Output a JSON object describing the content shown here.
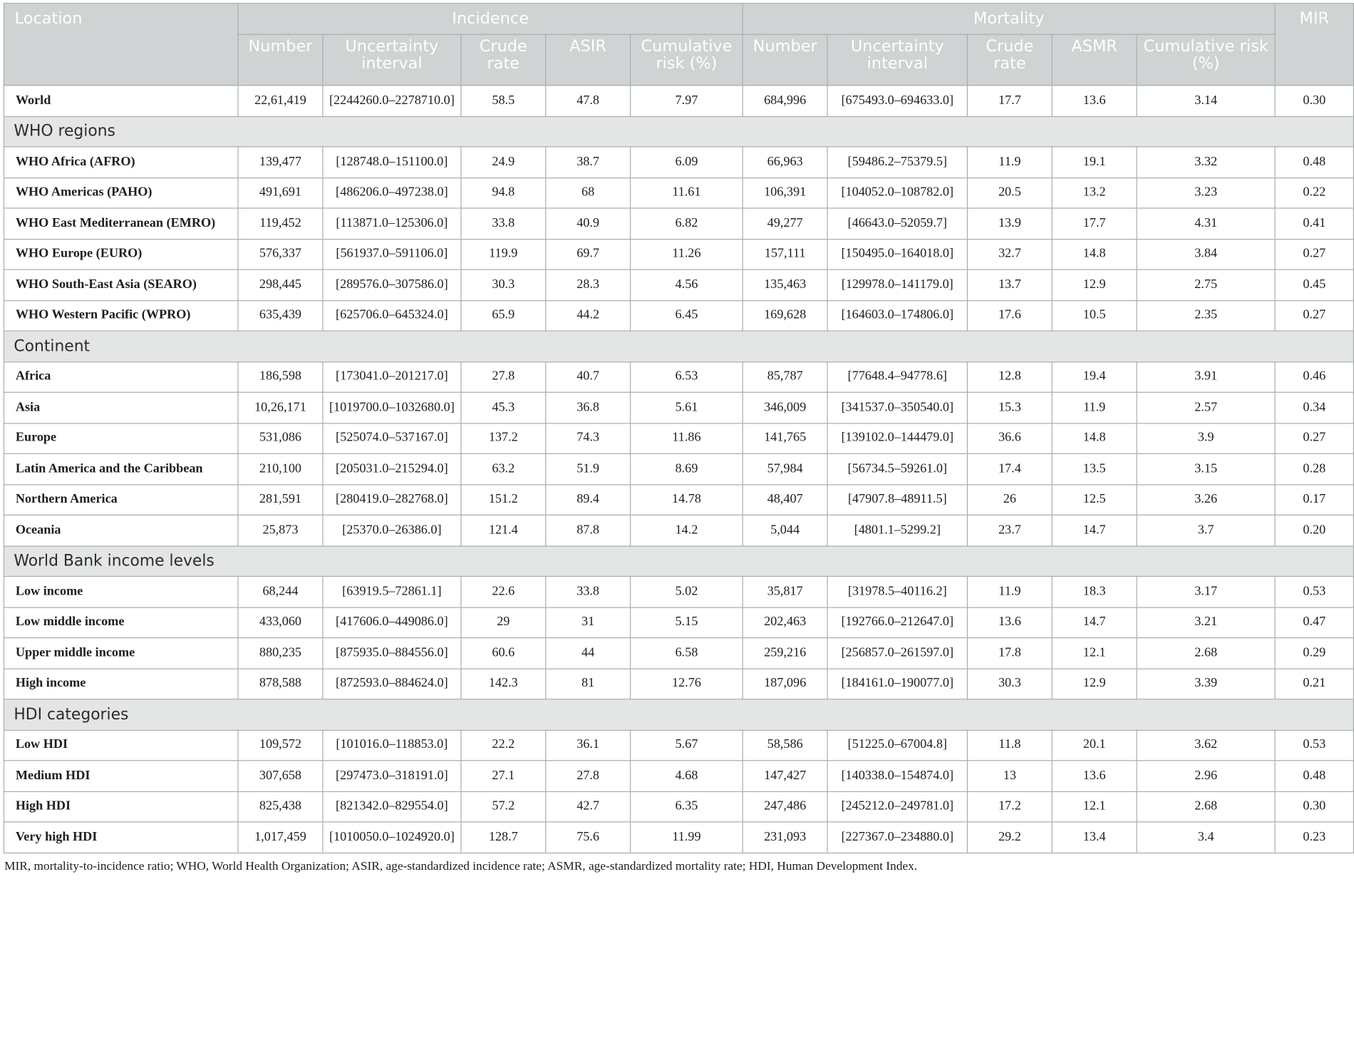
{
  "table": {
    "headers": {
      "location": "Location",
      "incidence": "Incidence",
      "mortality": "Mortality",
      "mir": "MIR",
      "inc_number": "Number",
      "inc_uncertainty": "Uncertainty interval",
      "inc_crude": "Crude rate",
      "inc_asir": "ASIR",
      "inc_cumrisk": "Cumulative risk (%)",
      "mort_number": "Number",
      "mort_uncertainty": "Uncertainty interval",
      "mort_crude": "Crude rate",
      "mort_asmr": "ASMR",
      "mort_cumrisk": "Cumulative risk (%)"
    },
    "world": [
      "World",
      "22,61,419",
      "[2244260.0–2278710.0]",
      "58.5",
      "47.8",
      "7.97",
      "684,996",
      "[675493.0–694633.0]",
      "17.7",
      "13.6",
      "3.14",
      "0.30"
    ],
    "groups": [
      {
        "title": "WHO regions",
        "rows": [
          [
            "WHO Africa (AFRO)",
            "139,477",
            "[128748.0–151100.0]",
            "24.9",
            "38.7",
            "6.09",
            "66,963",
            "[59486.2–75379.5]",
            "11.9",
            "19.1",
            "3.32",
            "0.48"
          ],
          [
            "WHO Americas (PAHO)",
            "491,691",
            "[486206.0–497238.0]",
            "94.8",
            "68",
            "11.61",
            "106,391",
            "[104052.0–108782.0]",
            "20.5",
            "13.2",
            "3.23",
            "0.22"
          ],
          [
            "WHO East Mediterranean (EMRO)",
            "119,452",
            "[113871.0–125306.0]",
            "33.8",
            "40.9",
            "6.82",
            "49,277",
            "[46643.0–52059.7]",
            "13.9",
            "17.7",
            "4.31",
            "0.41"
          ],
          [
            "WHO Europe (EURO)",
            "576,337",
            "[561937.0–591106.0]",
            "119.9",
            "69.7",
            "11.26",
            "157,111",
            "[150495.0–164018.0]",
            "32.7",
            "14.8",
            "3.84",
            "0.27"
          ],
          [
            "WHO South-East Asia (SEARO)",
            "298,445",
            "[289576.0–307586.0]",
            "30.3",
            "28.3",
            "4.56",
            "135,463",
            "[129978.0–141179.0]",
            "13.7",
            "12.9",
            "2.75",
            "0.45"
          ],
          [
            "WHO Western Pacific (WPRO)",
            "635,439",
            "[625706.0–645324.0]",
            "65.9",
            "44.2",
            "6.45",
            "169,628",
            "[164603.0–174806.0]",
            "17.6",
            "10.5",
            "2.35",
            "0.27"
          ]
        ]
      },
      {
        "title": "Continent",
        "rows": [
          [
            "Africa",
            "186,598",
            "[173041.0–201217.0]",
            "27.8",
            "40.7",
            "6.53",
            "85,787",
            "[77648.4–94778.6]",
            "12.8",
            "19.4",
            "3.91",
            "0.46"
          ],
          [
            "Asia",
            "10,26,171",
            "[1019700.0–1032680.0]",
            "45.3",
            "36.8",
            "5.61",
            "346,009",
            "[341537.0–350540.0]",
            "15.3",
            "11.9",
            "2.57",
            "0.34"
          ],
          [
            "Europe",
            "531,086",
            "[525074.0–537167.0]",
            "137.2",
            "74.3",
            "11.86",
            "141,765",
            "[139102.0–144479.0]",
            "36.6",
            "14.8",
            "3.9",
            "0.27"
          ],
          [
            "Latin America and the Caribbean",
            "210,100",
            "[205031.0–215294.0]",
            "63.2",
            "51.9",
            "8.69",
            "57,984",
            "[56734.5–59261.0]",
            "17.4",
            "13.5",
            "3.15",
            "0.28"
          ],
          [
            "Northern America",
            "281,591",
            "[280419.0–282768.0]",
            "151.2",
            "89.4",
            "14.78",
            "48,407",
            "[47907.8–48911.5]",
            "26",
            "12.5",
            "3.26",
            "0.17"
          ],
          [
            "Oceania",
            "25,873",
            "[25370.0–26386.0]",
            "121.4",
            "87.8",
            "14.2",
            "5,044",
            "[4801.1–5299.2]",
            "23.7",
            "14.7",
            "3.7",
            "0.20"
          ]
        ]
      },
      {
        "title": "World Bank income levels",
        "rows": [
          [
            "Low income",
            "68,244",
            "[63919.5–72861.1]",
            "22.6",
            "33.8",
            "5.02",
            "35,817",
            "[31978.5–40116.2]",
            "11.9",
            "18.3",
            "3.17",
            "0.53"
          ],
          [
            "Low middle income",
            "433,060",
            "[417606.0–449086.0]",
            "29",
            "31",
            "5.15",
            "202,463",
            "[192766.0–212647.0]",
            "13.6",
            "14.7",
            "3.21",
            "0.47"
          ],
          [
            "Upper middle income",
            "880,235",
            "[875935.0–884556.0]",
            "60.6",
            "44",
            "6.58",
            "259,216",
            "[256857.0–261597.0]",
            "17.8",
            "12.1",
            "2.68",
            "0.29"
          ],
          [
            "High income",
            "878,588",
            "[872593.0–884624.0]",
            "142.3",
            "81",
            "12.76",
            "187,096",
            "[184161.0–190077.0]",
            "30.3",
            "12.9",
            "3.39",
            "0.21"
          ]
        ]
      },
      {
        "title": "HDI categories",
        "rows": [
          [
            "Low HDI",
            "109,572",
            "[101016.0–118853.0]",
            "22.2",
            "36.1",
            "5.67",
            "58,586",
            "[51225.0–67004.8]",
            "11.8",
            "20.1",
            "3.62",
            "0.53"
          ],
          [
            "Medium HDI",
            "307,658",
            "[297473.0–318191.0]",
            "27.1",
            "27.8",
            "4.68",
            "147,427",
            "[140338.0–154874.0]",
            "13",
            "13.6",
            "2.96",
            "0.48"
          ],
          [
            "High HDI",
            "825,438",
            "[821342.0–829554.0]",
            "57.2",
            "42.7",
            "6.35",
            "247,486",
            "[245212.0–249781.0]",
            "17.2",
            "12.1",
            "2.68",
            "0.30"
          ],
          [
            "Very high HDI",
            "1,017,459",
            "[1010050.0–1024920.0]",
            "128.7",
            "75.6",
            "11.99",
            "231,093",
            "[227367.0–234880.0]",
            "29.2",
            "13.4",
            "3.4",
            "0.23"
          ]
        ]
      }
    ]
  },
  "footnote": "MIR, mortality-to-incidence ratio; WHO, World Health Organization; ASIR, age-standardized incidence rate; ASMR, age-standardized mortality rate; HDI, Human Development Index."
}
